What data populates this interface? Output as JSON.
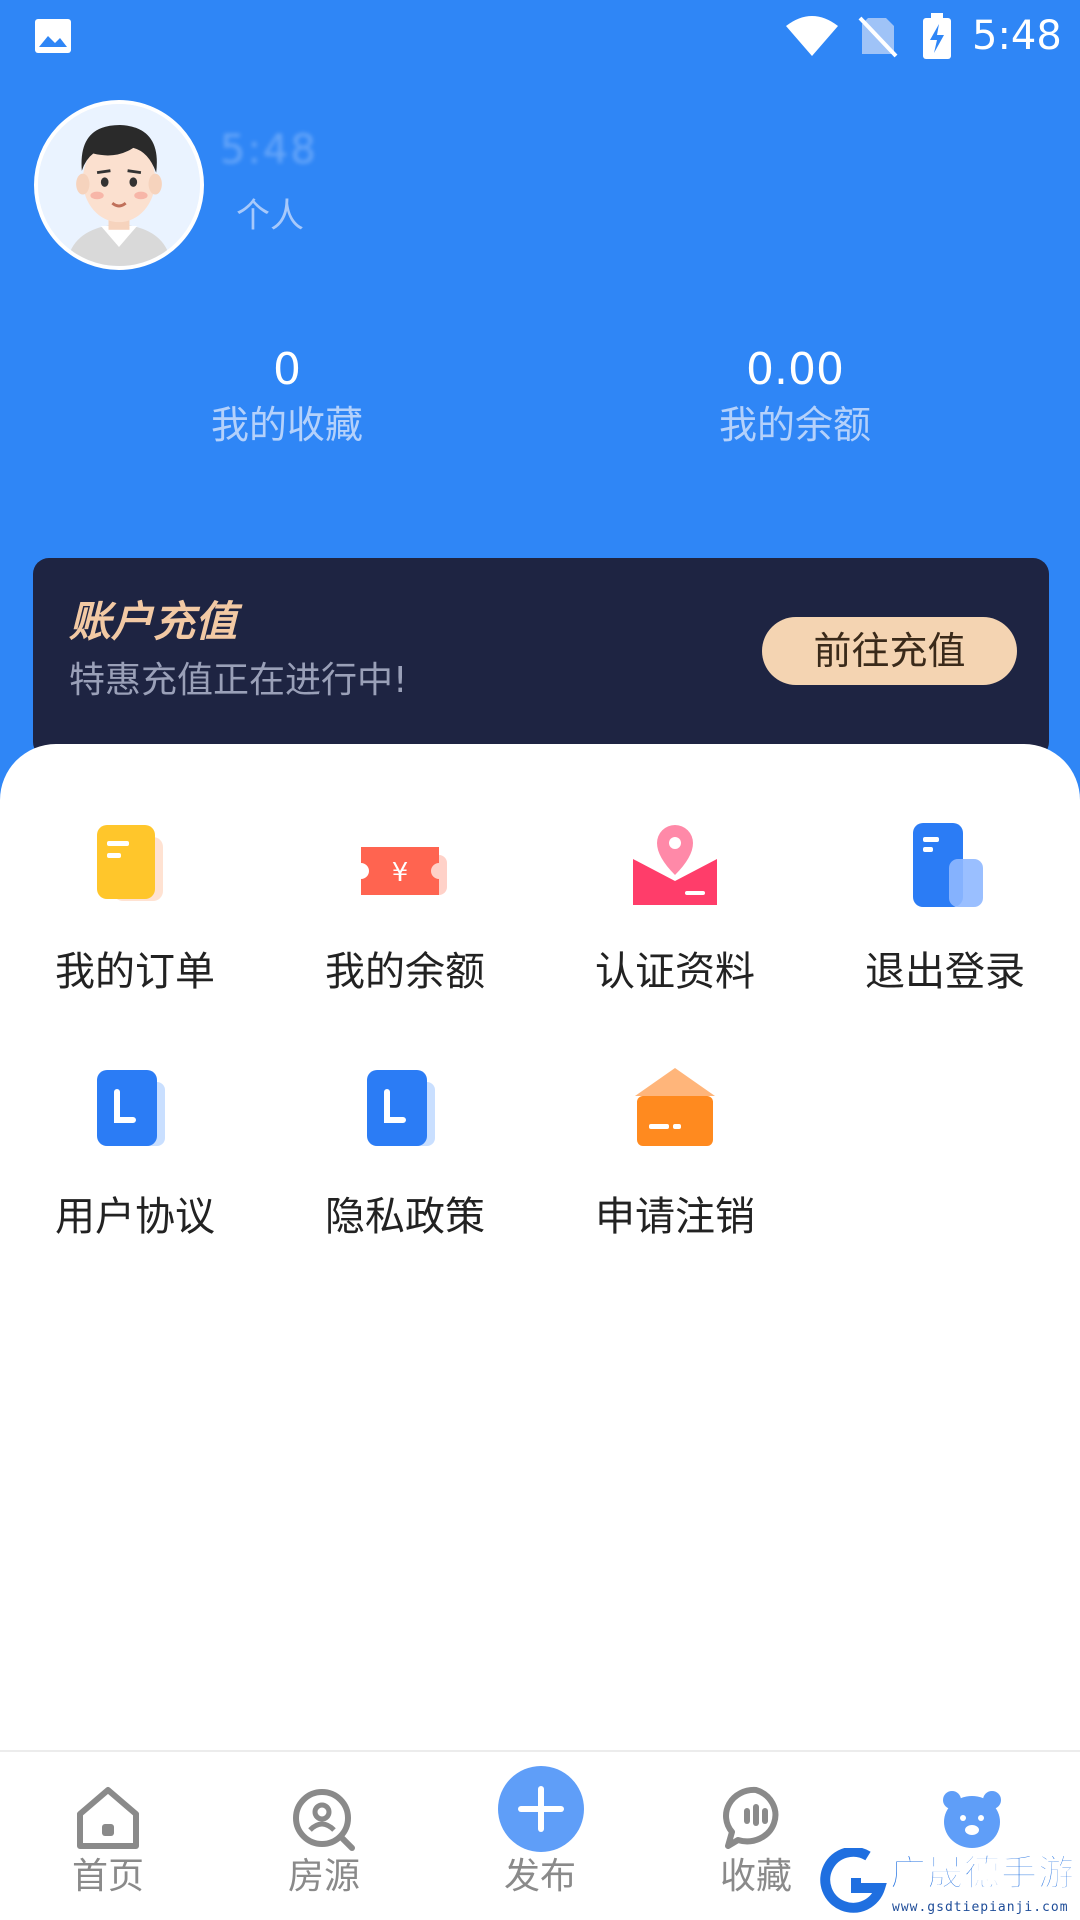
{
  "status_bar": {
    "time": "5:48",
    "icons": [
      "gallery-icon",
      "wifi-icon",
      "no-sim-icon",
      "battery-charging-icon"
    ]
  },
  "profile": {
    "avatar": "avatar-icon",
    "name_obscured": "5:48",
    "role": "个人"
  },
  "stats": [
    {
      "value": "0",
      "label": "我的收藏"
    },
    {
      "value": "0.00",
      "label": "我的余额"
    }
  ],
  "recharge": {
    "title": "账户充值",
    "subtitle": "特惠充值正在进行中!",
    "button": "前往充值"
  },
  "menu": [
    {
      "label": "我的订单",
      "icon": "order-icon"
    },
    {
      "label": "我的余额",
      "icon": "balance-ticket-icon"
    },
    {
      "label": "认证资料",
      "icon": "location-verify-icon"
    },
    {
      "label": "退出登录",
      "icon": "logout-icon"
    },
    {
      "label": "用户协议",
      "icon": "agreement-icon"
    },
    {
      "label": "隐私政策",
      "icon": "privacy-icon"
    },
    {
      "label": "申请注销",
      "icon": "cancel-account-icon"
    }
  ],
  "nav": [
    {
      "label": "首页",
      "icon": "home-icon"
    },
    {
      "label": "房源",
      "icon": "listing-search-icon"
    },
    {
      "label": "发布",
      "icon": "plus-icon"
    },
    {
      "label": "收藏",
      "icon": "chat-favorite-icon"
    },
    {
      "label": "",
      "icon": "bear-profile-icon"
    }
  ],
  "watermark": {
    "text": "广晟德手游",
    "url": "www.gsdtiepianji.com"
  },
  "colors": {
    "primary": "#2f86f6",
    "banner_bg": "#1e2442",
    "banner_accent": "#f4d4b2"
  }
}
